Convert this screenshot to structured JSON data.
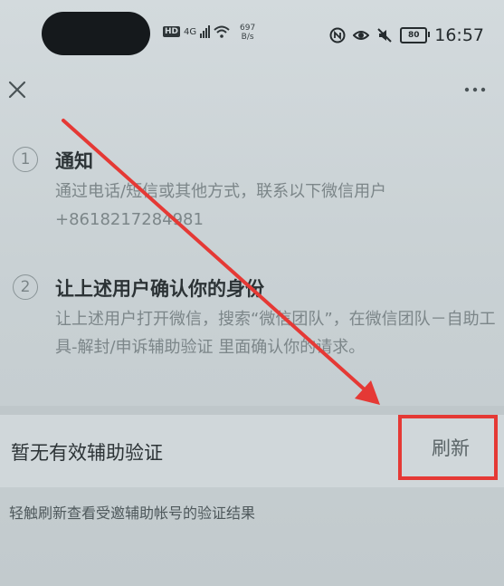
{
  "status_bar": {
    "network_badge": "HD",
    "network_type": "4G",
    "speed_value": "697",
    "speed_unit": "B/s",
    "battery_level": "80",
    "time": "16:57"
  },
  "header": {
    "close_icon": "close-icon",
    "more_icon": "more-icon"
  },
  "steps": [
    {
      "number": "1",
      "title": "通知",
      "description_line1": "通过电话/短信或其他方式，联系以下微信用户",
      "description_line2": "+8618217284981"
    },
    {
      "number": "2",
      "title": "让上述用户确认你的身份",
      "description": "让上述用户打开微信，搜索“微信团队”，在微信团队－自助工具-解封/申诉辅助验证 里面确认你的请求。"
    }
  ],
  "verification": {
    "status_label": "暂无有效辅助验证",
    "refresh_label": "刷新",
    "hint": "轻触刷新查看受邀辅助帐号的验证结果"
  },
  "colors": {
    "highlight_box": "#e53935",
    "annotation_arrow": "#e53935"
  }
}
